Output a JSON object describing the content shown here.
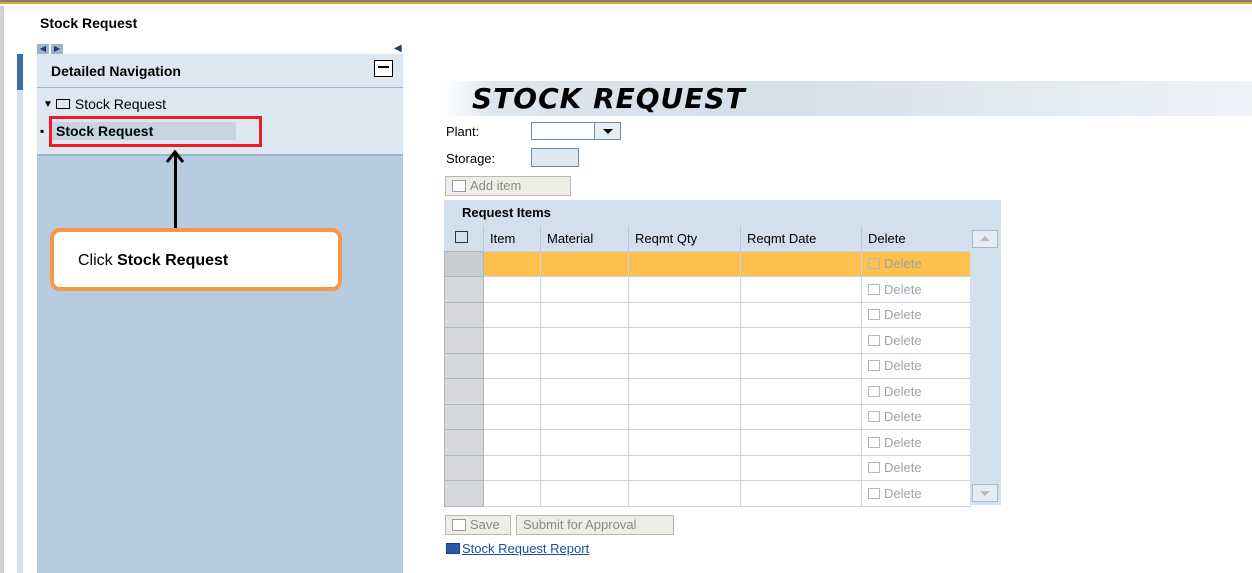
{
  "window": {
    "title": "Stock Request"
  },
  "navigation": {
    "header": "Detailed Navigation",
    "tree": {
      "parent_label": "Stock Request",
      "child_label": "Stock Request"
    }
  },
  "annotation": {
    "callout_prefix": "Click ",
    "callout_bold": "Stock Request",
    "highlight_color": "#ee1c24",
    "callout_border_color": "#f79646"
  },
  "form": {
    "title": "STOCK REQUEST",
    "plant_label": "Plant:",
    "plant_value": "",
    "storage_label": "Storage:",
    "storage_value": "",
    "add_item_label": "Add item"
  },
  "table": {
    "title": "Request Items",
    "columns": [
      "Item",
      "Material",
      "Reqmt Qty",
      "Reqmt Date",
      "Delete"
    ],
    "delete_label": "Delete",
    "selected_row_color": "#fdbf4d",
    "rows": [
      {
        "item": "",
        "material": "",
        "qty": "",
        "date": "",
        "delete": "Delete"
      },
      {
        "item": "",
        "material": "",
        "qty": "",
        "date": "",
        "delete": "Delete"
      },
      {
        "item": "",
        "material": "",
        "qty": "",
        "date": "",
        "delete": "Delete"
      },
      {
        "item": "",
        "material": "",
        "qty": "",
        "date": "",
        "delete": "Delete"
      },
      {
        "item": "",
        "material": "",
        "qty": "",
        "date": "",
        "delete": "Delete"
      },
      {
        "item": "",
        "material": "",
        "qty": "",
        "date": "",
        "delete": "Delete"
      },
      {
        "item": "",
        "material": "",
        "qty": "",
        "date": "",
        "delete": "Delete"
      },
      {
        "item": "",
        "material": "",
        "qty": "",
        "date": "",
        "delete": "Delete"
      },
      {
        "item": "",
        "material": "",
        "qty": "",
        "date": "",
        "delete": "Delete"
      },
      {
        "item": "",
        "material": "",
        "qty": "",
        "date": "",
        "delete": "Delete"
      }
    ]
  },
  "actions": {
    "save_label": "Save",
    "submit_label": "Submit for Approval",
    "report_link": "Stock Request Report"
  }
}
